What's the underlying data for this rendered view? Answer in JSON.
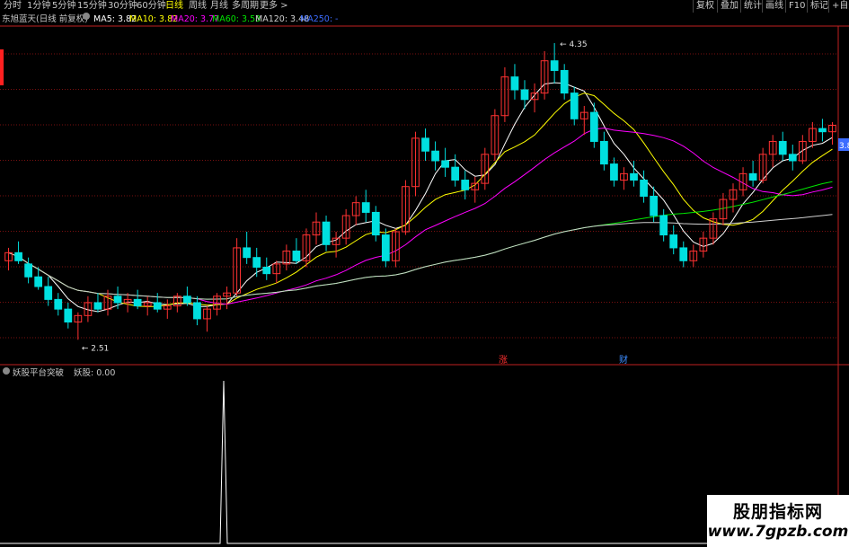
{
  "toolbar": {
    "periods": [
      "分时",
      "1分钟",
      "5分钟",
      "15分钟",
      "30分钟",
      "60分钟",
      "日线",
      "周线",
      "月线",
      "多周期",
      "更多 >"
    ],
    "active_period": "日线",
    "right_buttons": [
      "复权",
      "叠加",
      "统计",
      "画线",
      "F10",
      "标记",
      "+自选"
    ]
  },
  "main": {
    "title": "东旭蓝天(日线 前复权)",
    "ma_labels": [
      {
        "text": "MA5: 3.82",
        "color": "#ffffff"
      },
      {
        "text": "MA10: 3.82",
        "color": "#ffff00"
      },
      {
        "text": "MA20: 3.77",
        "color": "#ff00ff"
      },
      {
        "text": "MA60: 3.53",
        "color": "#00e600"
      },
      {
        "text": "MA120: 3.48",
        "color": "#d0d0d0"
      },
      {
        "text": "MA250: -",
        "color": "#3c6cff"
      }
    ],
    "price_axis_label": "3.8",
    "high_label": "4.35",
    "low_label": "2.51",
    "markers": [
      {
        "text": "涨",
        "color": "#ff3030"
      },
      {
        "text": "财",
        "color": "#3c8cff"
      }
    ]
  },
  "sub": {
    "indicator_name": "妖股平台突破",
    "value_label": "妖股: 0.00"
  },
  "watermark": {
    "line1": "股朋指标网",
    "line2": "www.7gpzb.com"
  },
  "colors": {
    "up": "#ff3232",
    "down": "#00e0e0",
    "grid": "#7a1010",
    "axis": "#c02020"
  },
  "chart_data": [
    {
      "type": "candlestick",
      "title": "东旭蓝天(日线 前复权)",
      "ylim": [
        2.4,
        4.45
      ],
      "ohlc": [
        [
          3.0,
          3.08,
          2.94,
          3.05
        ],
        [
          3.05,
          3.12,
          2.98,
          3.0
        ],
        [
          2.98,
          3.02,
          2.86,
          2.9
        ],
        [
          2.9,
          2.96,
          2.82,
          2.84
        ],
        [
          2.84,
          2.9,
          2.72,
          2.76
        ],
        [
          2.76,
          2.8,
          2.66,
          2.7
        ],
        [
          2.7,
          2.74,
          2.58,
          2.62
        ],
        [
          2.62,
          2.68,
          2.51,
          2.66
        ],
        [
          2.66,
          2.78,
          2.62,
          2.74
        ],
        [
          2.74,
          2.8,
          2.68,
          2.7
        ],
        [
          2.7,
          2.82,
          2.66,
          2.78
        ],
        [
          2.78,
          2.84,
          2.7,
          2.74
        ],
        [
          2.74,
          2.8,
          2.68,
          2.76
        ],
        [
          2.76,
          2.82,
          2.7,
          2.72
        ],
        [
          2.72,
          2.78,
          2.66,
          2.74
        ],
        [
          2.74,
          2.8,
          2.68,
          2.7
        ],
        [
          2.7,
          2.76,
          2.64,
          2.72
        ],
        [
          2.72,
          2.8,
          2.68,
          2.78
        ],
        [
          2.78,
          2.84,
          2.72,
          2.74
        ],
        [
          2.74,
          2.78,
          2.6,
          2.64
        ],
        [
          2.64,
          2.72,
          2.56,
          2.7
        ],
        [
          2.7,
          2.8,
          2.66,
          2.78
        ],
        [
          2.78,
          2.84,
          2.7,
          2.8
        ],
        [
          2.8,
          3.14,
          2.78,
          3.08
        ],
        [
          3.08,
          3.18,
          2.98,
          3.02
        ],
        [
          3.02,
          3.08,
          2.9,
          2.96
        ],
        [
          2.96,
          3.02,
          2.88,
          2.92
        ],
        [
          2.92,
          3.0,
          2.86,
          2.98
        ],
        [
          2.98,
          3.1,
          2.94,
          3.06
        ],
        [
          3.06,
          3.14,
          2.98,
          3.0
        ],
        [
          3.0,
          3.2,
          2.96,
          3.16
        ],
        [
          3.16,
          3.3,
          3.1,
          3.24
        ],
        [
          3.24,
          3.28,
          3.06,
          3.1
        ],
        [
          3.1,
          3.18,
          3.02,
          3.14
        ],
        [
          3.14,
          3.32,
          3.1,
          3.28
        ],
        [
          3.28,
          3.4,
          3.22,
          3.36
        ],
        [
          3.36,
          3.44,
          3.24,
          3.3
        ],
        [
          3.3,
          3.34,
          3.12,
          3.16
        ],
        [
          3.16,
          3.2,
          2.96,
          3.0
        ],
        [
          3.0,
          3.2,
          2.96,
          3.18
        ],
        [
          3.18,
          3.5,
          3.16,
          3.46
        ],
        [
          3.46,
          3.8,
          3.4,
          3.76
        ],
        [
          3.76,
          3.82,
          3.62,
          3.68
        ],
        [
          3.68,
          3.74,
          3.56,
          3.62
        ],
        [
          3.62,
          3.7,
          3.52,
          3.58
        ],
        [
          3.58,
          3.66,
          3.46,
          3.5
        ],
        [
          3.5,
          3.56,
          3.38,
          3.44
        ],
        [
          3.44,
          3.52,
          3.36,
          3.48
        ],
        [
          3.48,
          3.7,
          3.44,
          3.66
        ],
        [
          3.66,
          3.94,
          3.62,
          3.9
        ],
        [
          3.9,
          4.2,
          3.86,
          4.14
        ],
        [
          4.14,
          4.22,
          4.0,
          4.06
        ],
        [
          4.06,
          4.12,
          3.94,
          4.0
        ],
        [
          4.0,
          4.1,
          3.92,
          4.04
        ],
        [
          4.04,
          4.3,
          4.0,
          4.24
        ],
        [
          4.24,
          4.35,
          4.1,
          4.18
        ],
        [
          4.18,
          4.22,
          4.0,
          4.04
        ],
        [
          4.04,
          4.08,
          3.84,
          3.88
        ],
        [
          3.88,
          3.96,
          3.78,
          3.92
        ],
        [
          3.92,
          3.98,
          3.7,
          3.74
        ],
        [
          3.74,
          3.8,
          3.56,
          3.6
        ],
        [
          3.6,
          3.64,
          3.46,
          3.5
        ],
        [
          3.5,
          3.58,
          3.44,
          3.54
        ],
        [
          3.54,
          3.62,
          3.46,
          3.5
        ],
        [
          3.5,
          3.56,
          3.36,
          3.4
        ],
        [
          3.4,
          3.46,
          3.24,
          3.28
        ],
        [
          3.28,
          3.32,
          3.12,
          3.16
        ],
        [
          3.16,
          3.22,
          3.04,
          3.08
        ],
        [
          3.08,
          3.12,
          2.96,
          3.0
        ],
        [
          3.0,
          3.1,
          2.96,
          3.06
        ],
        [
          3.06,
          3.18,
          3.02,
          3.14
        ],
        [
          3.14,
          3.3,
          3.1,
          3.26
        ],
        [
          3.26,
          3.42,
          3.22,
          3.38
        ],
        [
          3.38,
          3.48,
          3.3,
          3.44
        ],
        [
          3.44,
          3.58,
          3.4,
          3.54
        ],
        [
          3.54,
          3.62,
          3.46,
          3.5
        ],
        [
          3.5,
          3.7,
          3.48,
          3.66
        ],
        [
          3.66,
          3.78,
          3.58,
          3.74
        ],
        [
          3.74,
          3.8,
          3.62,
          3.66
        ],
        [
          3.66,
          3.72,
          3.56,
          3.62
        ],
        [
          3.62,
          3.78,
          3.6,
          3.74
        ],
        [
          3.74,
          3.86,
          3.7,
          3.82
        ],
        [
          3.82,
          3.88,
          3.74,
          3.8
        ],
        [
          3.8,
          3.86,
          3.72,
          3.84
        ]
      ],
      "ma_series": [
        {
          "name": "MA5",
          "color": "#ffffff"
        },
        {
          "name": "MA10",
          "color": "#ffff00"
        },
        {
          "name": "MA20",
          "color": "#ff00ff"
        },
        {
          "name": "MA60",
          "color": "#00e600"
        },
        {
          "name": "MA120",
          "color": "#d0d0d0"
        }
      ]
    },
    {
      "type": "line",
      "title": "妖股平台突破",
      "series": [
        {
          "name": "妖股",
          "spike_index": 23,
          "spike_value": 1,
          "baseline": 0
        }
      ]
    }
  ]
}
